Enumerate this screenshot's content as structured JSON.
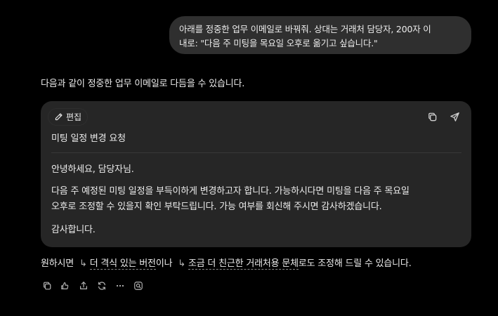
{
  "user_message": {
    "line1": "아래를 정중한 업무 이메일로 바꿔줘. 상대는 거래처 담당자, 200자 이",
    "line2": "내로: \"다음 주 미팅을 목요일 오후로 옮기고 싶습니다.\""
  },
  "assistant": {
    "intro": "다음과 같이 정중한 업무 이메일로 다듬을 수 있습니다.",
    "email": {
      "edit_label": "편집",
      "subject": "미팅 일정 변경 요청",
      "greeting": "안녕하세요, 담당자님.",
      "body_line1": "다음 주 예정된 미팅 일정을 부득이하게 변경하고자 합니다. 가능하시다면 미팅을 다음 주 목요일",
      "body_line2": "오후로 조정할 수 있을지 확인 부탁드립니다. 가능 여부를 회신해 주시면 감사하겠습니다.",
      "closing": "감사합니다."
    },
    "suggestion": {
      "prefix": "원하시면",
      "arrow": "↳",
      "option1": "더 격식 있는 버전",
      "middle": "이나",
      "option2": "조금 더 친근한 거래처용 문체",
      "suffix": "로도 조정해 드릴 수 있습니다."
    },
    "actions": [
      "copy-icon",
      "thumbs-icon",
      "share-icon",
      "regenerate-icon",
      "more-icon",
      "search-icon"
    ]
  },
  "colors": {
    "background": "#000000",
    "bubble": "#2f2f2f",
    "card": "#262626",
    "text": "#ececec",
    "icon": "#b4b4b4"
  }
}
